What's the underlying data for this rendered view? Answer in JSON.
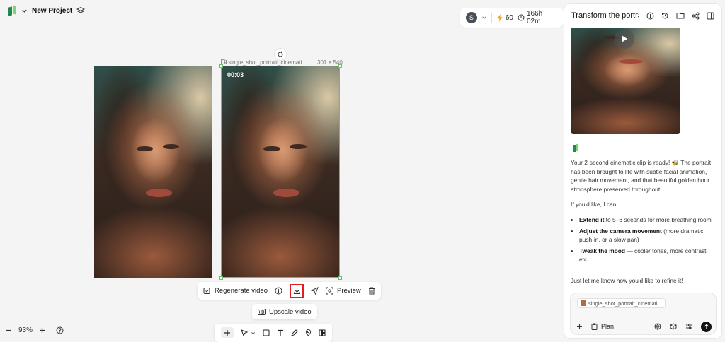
{
  "project": {
    "title": "New Project"
  },
  "account": {
    "avatar_letter": "S",
    "credits": "60",
    "time_remaining": "166h 02m"
  },
  "canvas": {
    "frame_name": "single_shot_portrait_cinemati...",
    "frame_size": "301 × 540",
    "timecode": "00:03"
  },
  "toolbar": {
    "regenerate_label": "Regenerate video",
    "preview_label": "Preview",
    "upscale_label": "Upscale video"
  },
  "zoom": {
    "level": "93%"
  },
  "panel": {
    "title": "Transform the portrait",
    "message_intro": "Your 2-second cinematic clip is ready! 🐝 The portrait has been brought to life with subtle facial animation, gentle hair movement, and that beautiful golden hour atmosphere preserved throughout.",
    "message_offer": "If you'd like, I can:",
    "options": [
      {
        "bold": "Extend it",
        "rest": " to 5–6 seconds for more breathing room"
      },
      {
        "bold": "Adjust the camera movement",
        "rest": " (more dramatic push-in, or a slow pan)"
      },
      {
        "bold": "Tweak the mood",
        "rest": " — cooler tones, more contrast, etc."
      }
    ],
    "message_outro": "Just let me know how you'd like to refine it!",
    "attachment_chip": "single_shot_portrait_cinemati...",
    "plan_label": "Plan"
  },
  "colors": {
    "accent_green": "#6bbf6b",
    "highlight_red": "#e02020",
    "send_bg": "#111111"
  }
}
